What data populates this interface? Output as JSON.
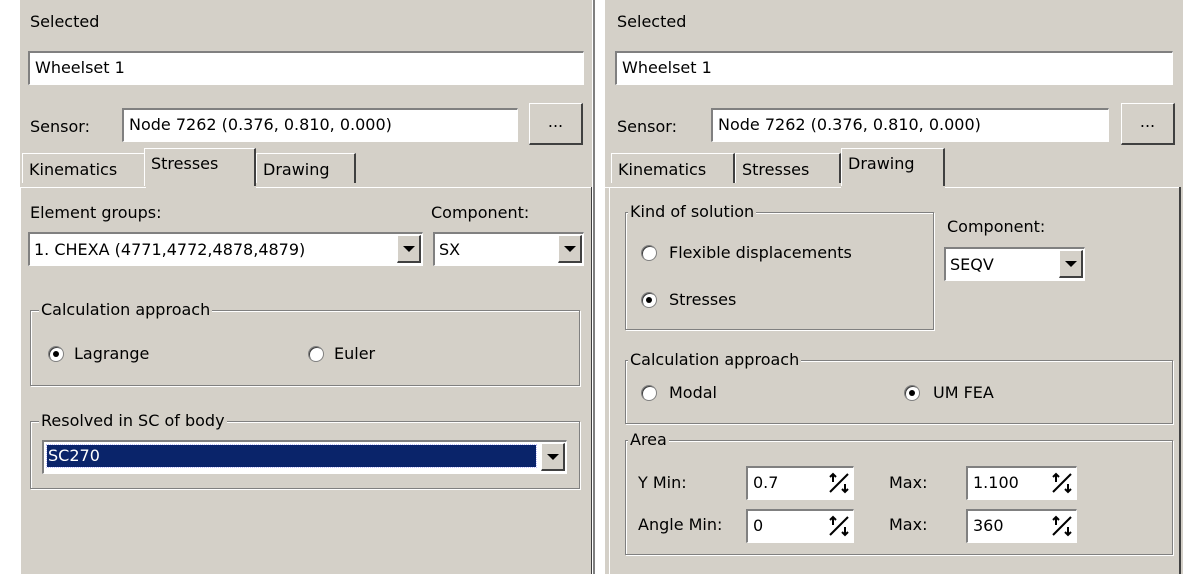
{
  "left": {
    "selected_label": "Selected",
    "selected_value": "Wheelset 1",
    "sensor_label": "Sensor:",
    "sensor_value": "Node 7262 (0.376,  0.810,  0.000)",
    "browse_label": "...",
    "tabs": [
      {
        "label": "Kinematics"
      },
      {
        "label": "Stresses"
      },
      {
        "label": "Drawing"
      }
    ],
    "active_tab": "Stresses",
    "element_groups_label": "Element groups:",
    "element_groups_value": "1. CHEXA (4771,4772,4878,4879)",
    "component_label": "Component:",
    "component_value": "SX",
    "calc_group_title": "Calculation approach",
    "calc_options": [
      {
        "label": "Lagrange",
        "selected": true
      },
      {
        "label": "Euler",
        "selected": false
      }
    ],
    "resolved_group_title": "Resolved in SC of body",
    "resolved_value": "SC270"
  },
  "right": {
    "selected_label": "Selected",
    "selected_value": "Wheelset 1",
    "sensor_label": "Sensor:",
    "sensor_value": "Node 7262 (0.376,  0.810,  0.000)",
    "browse_label": "...",
    "tabs": [
      {
        "label": "Kinematics"
      },
      {
        "label": "Stresses"
      },
      {
        "label": "Drawing"
      }
    ],
    "active_tab": "Drawing",
    "kind_group_title": "Kind of solution",
    "kind_options": [
      {
        "label": "Flexible displacements",
        "selected": false
      },
      {
        "label": "Stresses",
        "selected": true
      }
    ],
    "component_label": "Component:",
    "component_value": "SEQV",
    "calc_group_title": "Calculation approach",
    "calc_options": [
      {
        "label": "Modal",
        "selected": false
      },
      {
        "label": "UM FEA",
        "selected": true
      }
    ],
    "area_group_title": "Area",
    "y_min_label": "Y Min:",
    "y_min_value": "0.7",
    "y_max_label": "Max:",
    "y_max_value": "1.100",
    "angle_min_label": "Angle Min:",
    "angle_min_value": "0",
    "angle_max_label": "Max:",
    "angle_max_value": "360"
  },
  "colors": {
    "panel_bg": "#d4d0c8",
    "selection": "#0a246a"
  }
}
